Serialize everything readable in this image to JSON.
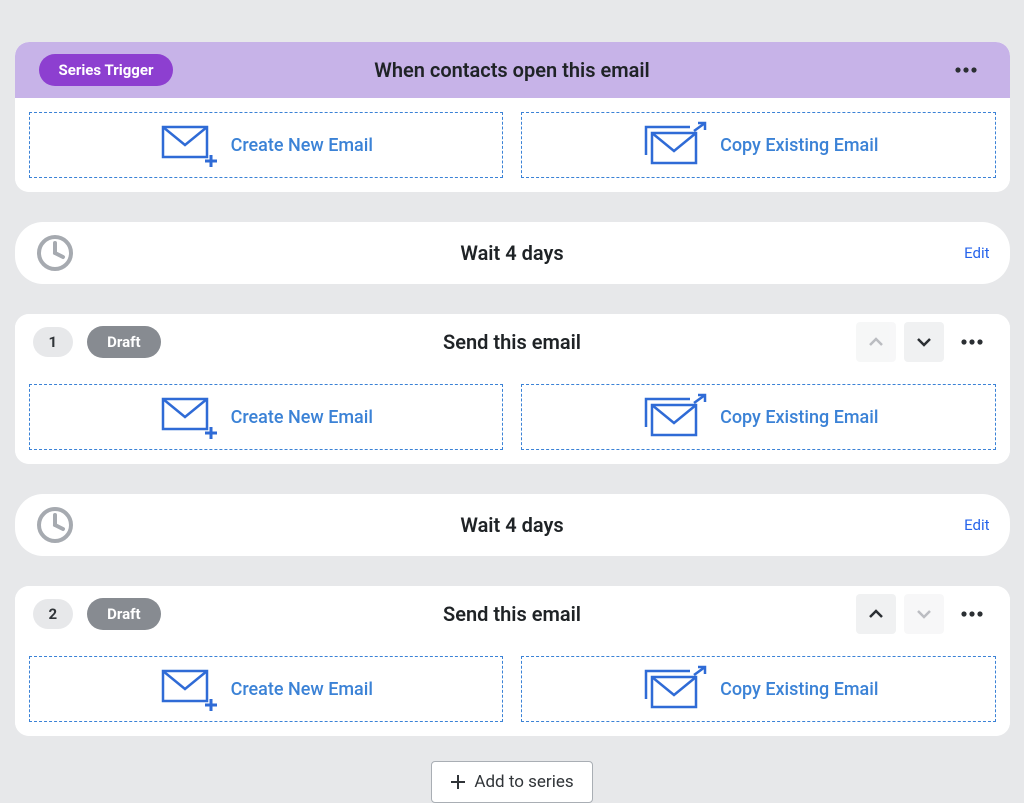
{
  "trigger": {
    "badge": "Series Trigger",
    "title": "When contacts open this email"
  },
  "options": {
    "create": "Create New Email",
    "copy": "Copy Existing Email"
  },
  "waits": [
    {
      "label": "Wait 4 days",
      "edit": "Edit"
    },
    {
      "label": "Wait 4 days",
      "edit": "Edit"
    }
  ],
  "steps": [
    {
      "num": "1",
      "status": "Draft",
      "title": "Send this email"
    },
    {
      "num": "2",
      "status": "Draft",
      "title": "Send this email"
    }
  ],
  "add_button": "Add to series"
}
